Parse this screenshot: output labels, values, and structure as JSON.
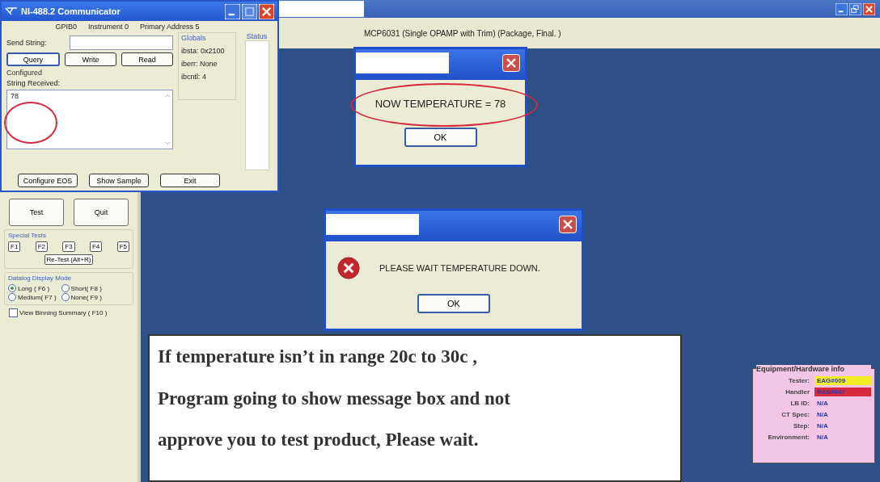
{
  "communicator": {
    "title": "NI-488.2 Communicator",
    "info": [
      "GPIB0",
      "Instrument 0",
      "Primary Address 5"
    ],
    "send_label": "Send String:",
    "buttons": [
      "Query",
      "Write",
      "Read"
    ],
    "globals": {
      "title": "Globals",
      "lines": [
        "ibsta: 0x2100",
        "iberr: None",
        "ibcntl: 4"
      ]
    },
    "status_label": "Status",
    "state_text": "Configured",
    "received_label": "String Received:",
    "received_value": "78",
    "bottom_buttons": [
      "Configure EOS",
      "Show Sample",
      "Exit"
    ]
  },
  "main_window": {
    "header": "MCP6031 (Single OPAMP with Trim) (Package, Final. )"
  },
  "control_panel": {
    "buttons": [
      "Test",
      "Quit"
    ],
    "special_tests": {
      "title": "Special Tests",
      "keys": [
        "F1",
        "F2",
        "F3",
        "F4",
        "F5"
      ],
      "retest": "Re-Test  (Alt+R)"
    },
    "display_mode": {
      "title": "Datalog Display Mode",
      "options": [
        {
          "label": "Long    ( F6 )",
          "selected": true
        },
        {
          "label": "Short( F8 )",
          "selected": false
        },
        {
          "label": "Medium( F7 )",
          "selected": false
        },
        {
          "label": "None( F9 )",
          "selected": false
        }
      ]
    },
    "binning": {
      "label": "View Binning Summary ( F10 )",
      "checked": false
    }
  },
  "temperature_dialog": {
    "message": "NOW TEMPERATURE =  78",
    "button": "OK"
  },
  "wait_dialog": {
    "message": "PLEASE WAIT TEMPERATURE DOWN.",
    "button": "OK"
  },
  "equipment_info": {
    "title": "Equipment/Hardware info",
    "rows": [
      {
        "label": "Tester:",
        "value": "EAG#009",
        "color": "#f4ee24"
      },
      {
        "label": "Handler",
        "value": "RAS#047",
        "color": "#d8283c"
      },
      {
        "label": "LB ID:",
        "value": "N/A"
      },
      {
        "label": "CT Spec:",
        "value": "N/A"
      },
      {
        "label": "Step:",
        "value": "N/A"
      },
      {
        "label": "Environment:",
        "value": "N/A"
      }
    ]
  },
  "note": {
    "lines": [
      "If temperature isn’t in range 20c to 30c ,",
      "Program going to show message box and not",
      "approve you to test product, Please wait."
    ]
  }
}
